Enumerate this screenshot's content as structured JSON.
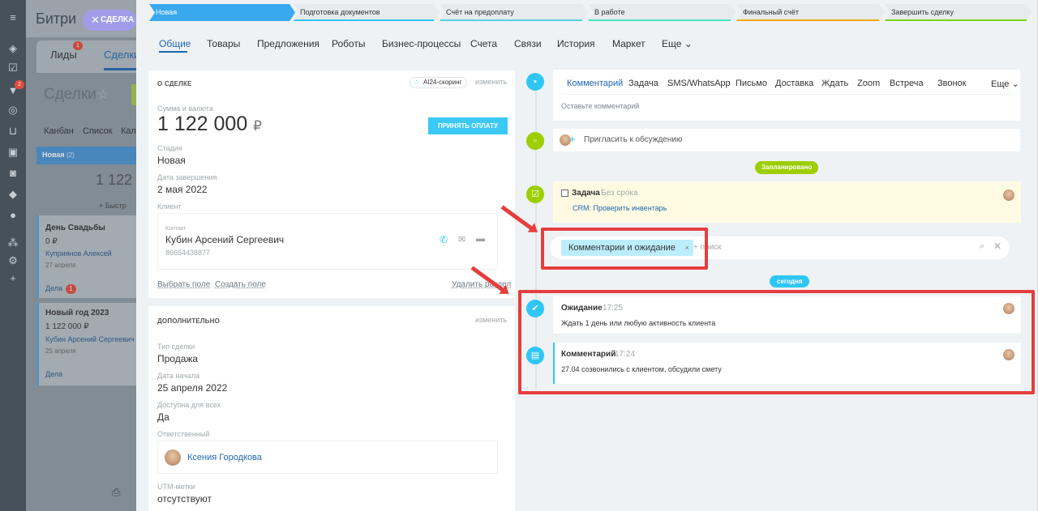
{
  "background": {
    "title": "Битри",
    "tabs": [
      "Лиды",
      "Сделки"
    ],
    "leads_badge": "1",
    "page_title": "Сделки",
    "views": [
      "Канбан",
      "Список",
      "Кал"
    ],
    "column_title": "Новая",
    "column_count": "(2)",
    "column_sum": "1 122",
    "quick_add": "+ Быстр",
    "deals": [
      {
        "title": "День Свадьбы",
        "sum": "0 ₽",
        "client": "Куприянов Алексей",
        "date": "27 апреля",
        "footer": "Дела",
        "badge": "1"
      },
      {
        "title": "Новый год 2023",
        "sum": "1 122 000 ₽",
        "client": "Кубин Арсений Сергеевич",
        "date": "25 апреля",
        "footer": "Дела"
      }
    ],
    "rail_badge": "2"
  },
  "close_button": {
    "label": "СДЕЛКА"
  },
  "stages": [
    {
      "label": "Новая",
      "color": "#39a8ef",
      "active": true
    },
    {
      "label": "Подготовка документов",
      "color": "#2fc6f6"
    },
    {
      "label": "Счёт на предоплату",
      "color": "#55d0e0"
    },
    {
      "label": "В работе",
      "color": "#47e4c2"
    },
    {
      "label": "Финальный счёт",
      "color": "#ffa900"
    },
    {
      "label": "Завершить сделку",
      "color": "#7bd500"
    }
  ],
  "tabs": [
    "Общие",
    "Товары",
    "Предложения",
    "Роботы",
    "Бизнес-процессы",
    "Счета",
    "Связи",
    "История",
    "Маркет",
    "Еще"
  ],
  "about": {
    "heading": "О СДЕЛКЕ",
    "ai_label": "AI24-скоринг",
    "edit": "изменить",
    "sum_label": "Сумма и валюта",
    "sum_value": "1 122 000",
    "currency": "₽",
    "pay_button": "ПРИНЯТЬ ОПЛАТУ",
    "stage_label": "Стадия",
    "stage_value": "Новая",
    "close_label": "Дата завершения",
    "close_value": "2 мая 2022",
    "client_label": "Клиент",
    "contact_label": "Контакт",
    "contact_name": "Кубин Арсений Сергеевич",
    "contact_phone": "86654438877",
    "select_field": "Выбрать поле",
    "create_field": "Создать поле",
    "delete_section": "Удалить раздел"
  },
  "extra": {
    "heading": "ДОПОЛНИТЕЛЬНО",
    "edit": "изменить",
    "type_label": "Тип сделки",
    "type_value": "Продажа",
    "start_label": "Дата начала",
    "start_value": "25 апреля 2022",
    "access_label": "Доступна для всех",
    "access_value": "Да",
    "resp_label": "Ответственный",
    "resp_value": "Ксения Городкова",
    "utm_label": "UTM-метки",
    "utm_value": "отсутствуют"
  },
  "timeline": {
    "composer_tabs": [
      "Комментарий",
      "Задача",
      "SMS/WhatsApp",
      "Письмо",
      "Доставка",
      "Ждать",
      "Zoom",
      "Встреча",
      "Звонок",
      "Еще"
    ],
    "composer_placeholder": "Оставьте комментарий",
    "invite": "Пригласить к обсуждению",
    "planned_label": "Запланировано",
    "task_title": "Задача",
    "task_deadline": "Без срока",
    "task_text": "CRM: Проверить инвентарь",
    "filter_chip": "Комментарии и ожидание",
    "filter_search": "+ поиск",
    "today_label": "сегодня",
    "wait_title": "Ожидание",
    "wait_time": "17:25",
    "wait_text": "Ждать 1 день или любую активность клиента",
    "comment_title": "Комментарий",
    "comment_time": "17:24",
    "comment_text": "27.04 созвонились с клиентом, обсудили смету"
  },
  "colors": {
    "accent": "#2fc6f6",
    "highlight": "#e53e3e",
    "planned": "#9dcf00",
    "green_icon": "#7fc61e"
  }
}
